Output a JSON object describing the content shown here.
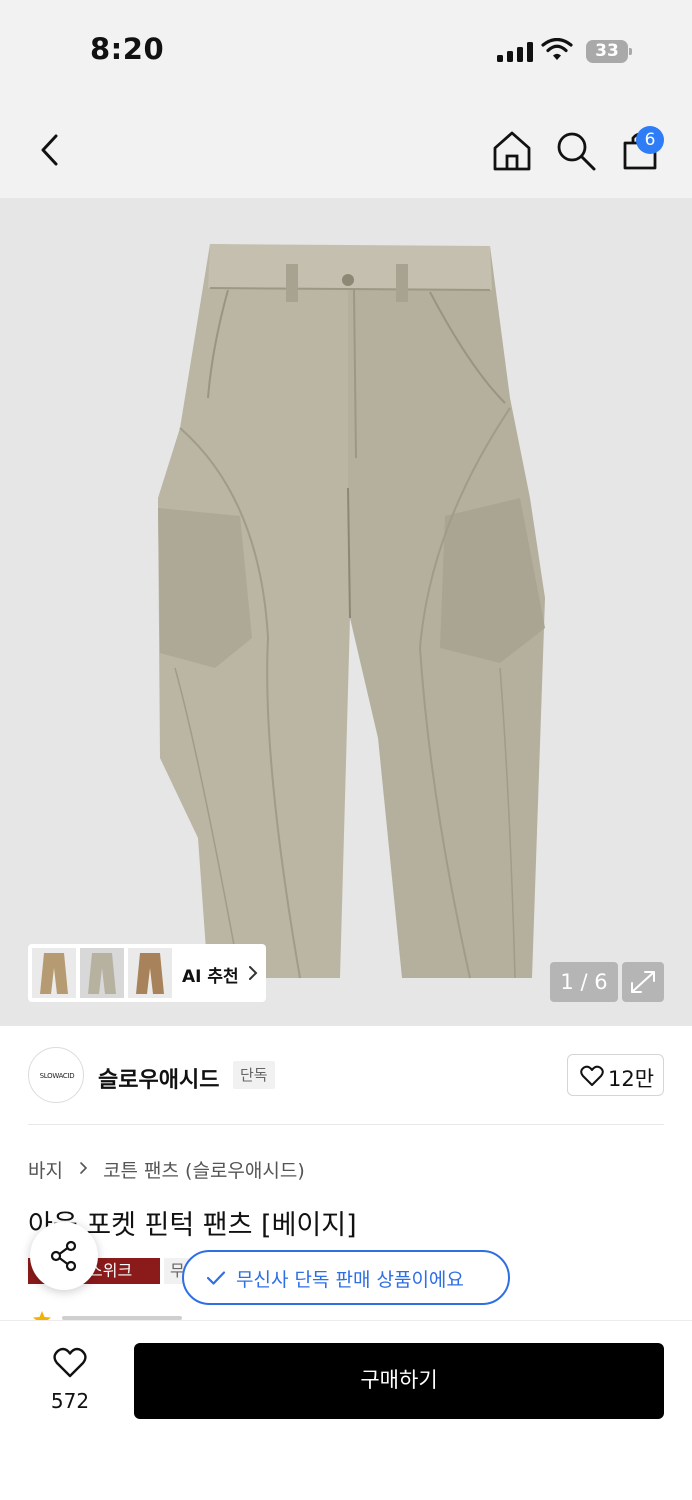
{
  "status_bar": {
    "time": "8:20",
    "battery": "33"
  },
  "nav": {
    "cart_count": "6"
  },
  "gallery": {
    "ai_label": "AI 추천",
    "counter": "1 / 6"
  },
  "brand": {
    "logo_text": "SLOWACID",
    "name": "슬로우애시드",
    "tag": "단독",
    "likes": "12만"
  },
  "breadcrumb": {
    "category": "바지",
    "subcategory": "코튼 팬츠 (슬로우애시드)"
  },
  "product": {
    "title": "아웃 포켓 핀턱 팬츠 [베이지]",
    "badge_red": "스위크",
    "badge_gray": "무"
  },
  "toast": {
    "text": "무신사 단독 판매 상품이에요"
  },
  "bottom": {
    "wish_count": "572",
    "buy_label": "구매하기"
  },
  "colors": {
    "accent_blue": "#2e6fe3",
    "cart_badge": "#2e7cf6",
    "badge_red": "#8b1a1a",
    "buy_button": "#000000"
  }
}
